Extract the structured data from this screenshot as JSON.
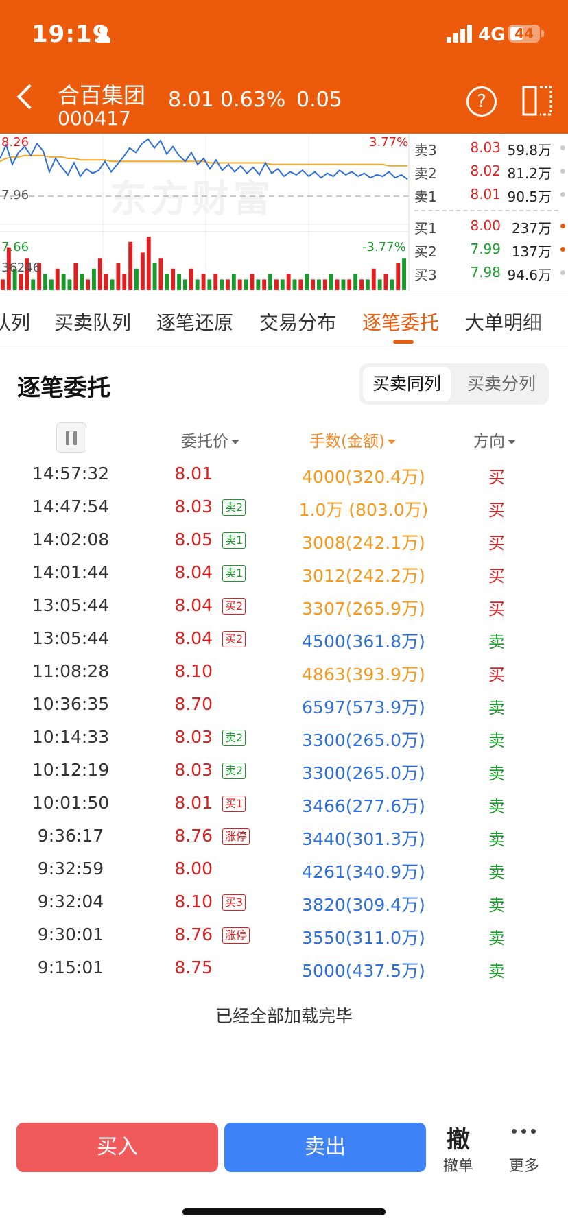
{
  "status_bar": {
    "time": "19:19",
    "network": "4G",
    "battery": "44"
  },
  "header": {
    "stock_name": "合百集团",
    "stock_code": "000417",
    "price": "8.01",
    "change_pct": "0.63%",
    "change": "0.05",
    "help_symbol": "?"
  },
  "chart": {
    "high_label": "8.26",
    "mid_label": "7.96",
    "low_label": "7.66",
    "up_pct_label": "3.77%",
    "down_pct_label": "-3.77%",
    "volume_label": "36246",
    "watermark": "东方财富",
    "colors": {
      "price_line": "#2f6fd6",
      "avg_line": "#f5a623",
      "up": "#e02020",
      "down": "#1a9a2a"
    }
  },
  "chart_data": {
    "type": "line",
    "ylim": [
      7.66,
      8.26
    ],
    "series": [
      {
        "values": [
          8.14,
          8.23,
          8.1,
          8.18,
          8.22,
          8.16,
          8.24,
          8.19,
          8.05,
          8.14,
          8.08,
          8.03,
          8.11,
          8.02,
          8.07,
          8.04,
          8.06,
          8.12,
          8.05,
          8.1,
          8.15,
          8.21,
          8.18,
          8.24,
          8.27,
          8.21,
          8.26,
          8.17,
          8.22,
          8.16,
          8.12,
          8.18,
          8.1,
          8.14,
          8.07,
          8.13,
          8.06,
          8.1,
          8.05,
          8.09,
          8.04,
          8.08,
          8.03,
          8.11,
          8.04,
          8.07,
          8.02,
          8.05,
          8.03,
          8.06,
          8.02,
          8.05,
          8.01,
          8.04,
          8.02,
          8.06,
          8.03,
          8.05,
          8.02,
          8.04,
          8.01,
          8.03,
          8.02,
          8.05,
          8.01,
          8.03,
          8.0
        ]
      },
      {
        "values": [
          8.12,
          8.14,
          8.15,
          8.15,
          8.16,
          8.16,
          8.16,
          8.16,
          8.15,
          8.15,
          8.15,
          8.14,
          8.14,
          8.13,
          8.13,
          8.13,
          8.13,
          8.13,
          8.12,
          8.12,
          8.12,
          8.12,
          8.12,
          8.12,
          8.12,
          8.12,
          8.12,
          8.12,
          8.12,
          8.12,
          8.12,
          8.12,
          8.12,
          8.12,
          8.11,
          8.11,
          8.11,
          8.11,
          8.11,
          8.11,
          8.11,
          8.11,
          8.11,
          8.11,
          8.1,
          8.1,
          8.1,
          8.1,
          8.1,
          8.1,
          8.1,
          8.1,
          8.1,
          8.1,
          8.1,
          8.1,
          8.1,
          8.1,
          8.1,
          8.1,
          8.1,
          8.1,
          8.1,
          8.09,
          8.09,
          8.09,
          8.09
        ]
      }
    ],
    "volume": [
      0.2,
      0.8,
      0.4,
      0.3,
      0.6,
      0.2,
      0.5,
      0.3,
      0.2,
      0.4,
      0.3,
      0.2,
      0.5,
      0.3,
      0.2,
      0.4,
      0.6,
      0.3,
      0.2,
      0.5,
      0.3,
      0.9,
      0.4,
      0.7,
      1.0,
      0.5,
      0.6,
      0.3,
      0.4,
      0.3,
      0.2,
      0.4,
      0.2,
      0.3,
      0.2,
      0.3,
      0.2,
      0.2,
      0.3,
      0.2,
      0.2,
      0.3,
      0.2,
      0.2,
      0.3,
      0.2,
      0.2,
      0.3,
      0.2,
      0.2,
      0.3,
      0.2,
      0.2,
      0.2,
      0.3,
      0.2,
      0.2,
      0.2,
      0.3,
      0.2,
      0.2,
      0.4,
      0.2,
      0.3,
      0.2,
      0.5,
      0.6
    ]
  },
  "order_book": {
    "sell": [
      {
        "label": "卖3",
        "price": "8.03",
        "volume": "59.8万"
      },
      {
        "label": "卖2",
        "price": "8.02",
        "volume": "81.2万"
      },
      {
        "label": "卖1",
        "price": "8.01",
        "volume": "90.5万"
      }
    ],
    "buy": [
      {
        "label": "买1",
        "price": "8.00",
        "volume": "237万"
      },
      {
        "label": "买2",
        "price": "7.99",
        "volume": "137万"
      },
      {
        "label": "买3",
        "price": "7.98",
        "volume": "94.6万"
      }
    ]
  },
  "tabs": [
    "队列",
    "买卖队列",
    "逐笔还原",
    "交易分布",
    "逐笔委托",
    "大单明细"
  ],
  "section": {
    "title": "逐笔委托",
    "seg_on": "买卖同列",
    "seg_off": "买卖分列"
  },
  "columns": {
    "price": "委托价",
    "amount": "手数(金额)",
    "direction": "方向"
  },
  "rows": [
    {
      "time": "14:57:32",
      "price": "8.01",
      "tag": "",
      "amount": "4000(320.4万)",
      "dir": "买"
    },
    {
      "time": "14:47:54",
      "price": "8.03",
      "tag": "卖2",
      "amount": "1.0万 (803.0万)",
      "dir": "买"
    },
    {
      "time": "14:02:08",
      "price": "8.05",
      "tag": "卖1",
      "amount": "3008(242.1万)",
      "dir": "买"
    },
    {
      "time": "14:01:44",
      "price": "8.04",
      "tag": "卖1",
      "amount": "3012(242.2万)",
      "dir": "买"
    },
    {
      "time": "13:05:44",
      "price": "8.04",
      "tag": "买2",
      "amount": "3307(265.9万)",
      "dir": "买"
    },
    {
      "time": "13:05:44",
      "price": "8.04",
      "tag": "买2",
      "amount": "4500(361.8万)",
      "dir": "卖"
    },
    {
      "time": "11:08:28",
      "price": "8.10",
      "tag": "",
      "amount": "4863(393.9万)",
      "dir": "买"
    },
    {
      "time": "10:36:35",
      "price": "8.70",
      "tag": "",
      "amount": "6597(573.9万)",
      "dir": "卖"
    },
    {
      "time": "10:14:33",
      "price": "8.03",
      "tag": "卖2",
      "amount": "3300(265.0万)",
      "dir": "卖"
    },
    {
      "time": "10:12:19",
      "price": "8.03",
      "tag": "卖2",
      "amount": "3300(265.0万)",
      "dir": "卖"
    },
    {
      "time": "10:01:50",
      "price": "8.01",
      "tag": "买1",
      "amount": "3466(277.6万)",
      "dir": "卖"
    },
    {
      "time": "9:36:17",
      "price": "8.76",
      "tag": "涨停",
      "amount": "3440(301.3万)",
      "dir": "卖"
    },
    {
      "time": "9:32:59",
      "price": "8.00",
      "tag": "",
      "amount": "4261(340.9万)",
      "dir": "卖"
    },
    {
      "time": "9:32:04",
      "price": "8.10",
      "tag": "买3",
      "amount": "3820(309.4万)",
      "dir": "卖"
    },
    {
      "time": "9:30:01",
      "price": "8.76",
      "tag": "涨停",
      "amount": "3550(311.0万)",
      "dir": "卖"
    },
    {
      "time": "9:15:01",
      "price": "8.75",
      "tag": "",
      "amount": "5000(437.5万)",
      "dir": "卖"
    }
  ],
  "footer": {
    "loaded_text": "已经全部加载完毕",
    "buy": "买入",
    "sell": "卖出",
    "cancel_icon": "撤",
    "cancel": "撤单",
    "more": "更多"
  }
}
